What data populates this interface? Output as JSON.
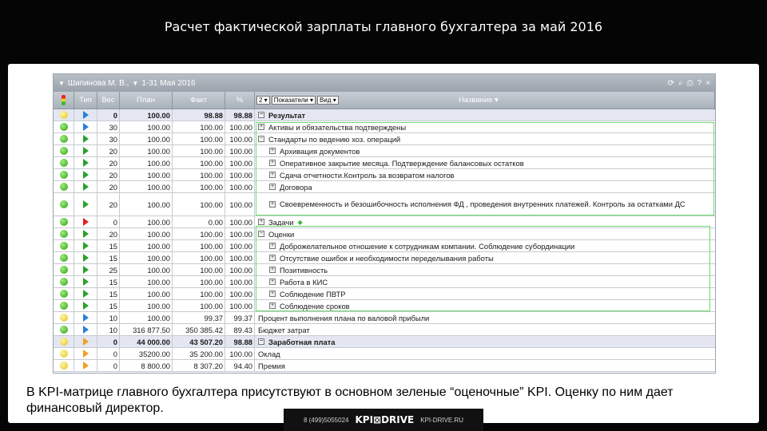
{
  "slide_title": "Расчет фактической зарплаты главного бухгалтера за май 2016",
  "window": {
    "user": "Шипинова М. В.,",
    "period": "1-31 Мая 2016",
    "icons": [
      "refresh-icon",
      "search-icon",
      "print-icon",
      "help-icon",
      "close-icon"
    ],
    "icon_glyphs": [
      "⟳",
      "🔍",
      "⎙",
      "?",
      "×"
    ]
  },
  "columns": {
    "type": "Тип",
    "weight": "Вес",
    "plan": "План",
    "fact": "Факт",
    "percent": "%",
    "level": "2",
    "indicators": "Показатели",
    "view": "Вид",
    "name": "Название"
  },
  "rows": [
    {
      "status": "yellow",
      "flag": "blue",
      "weight": "0",
      "plan": "100.00",
      "fact": "98.88",
      "pct": "98.88",
      "name": "Результат",
      "tree": "minus",
      "indent": 0,
      "bold": true,
      "hl": true
    },
    {
      "status": "green",
      "flag": "blue",
      "weight": "30",
      "plan": "100.00",
      "fact": "100.00",
      "pct": "100.00",
      "name": "Активы и обязательства подтверждены",
      "tree": "plus",
      "indent": 1
    },
    {
      "status": "green",
      "flag": "green",
      "weight": "30",
      "plan": "100.00",
      "fact": "100.00",
      "pct": "100.00",
      "name": "Стандарты по ведению хоз. операций",
      "tree": "minus",
      "indent": 1
    },
    {
      "status": "green",
      "flag": "green",
      "weight": "20",
      "plan": "100.00",
      "fact": "100.00",
      "pct": "100.00",
      "name": "Архивация документов",
      "tree": "plus",
      "indent": 2
    },
    {
      "status": "green",
      "flag": "green",
      "weight": "20",
      "plan": "100.00",
      "fact": "100.00",
      "pct": "100.00",
      "name": "Оперативное закрытие месяца. Подтверждение балансовых остатков",
      "tree": "plus",
      "indent": 2
    },
    {
      "status": "green",
      "flag": "green",
      "weight": "20",
      "plan": "100.00",
      "fact": "100.00",
      "pct": "100.00",
      "name": "Сдача отчетности.Контроль за возвратом налогов",
      "tree": "plus",
      "indent": 2
    },
    {
      "status": "green",
      "flag": "green",
      "weight": "20",
      "plan": "100.00",
      "fact": "100.00",
      "pct": "100.00",
      "name": "Договора",
      "tree": "plus",
      "indent": 2
    },
    {
      "status": "green",
      "flag": "green",
      "weight": "20",
      "plan": "100.00",
      "fact": "100.00",
      "pct": "100.00",
      "name": "Своевременность и безошибочность исполнения ФД , проведения внутренних платежей. Контроль за остатками ДС",
      "tree": "plus",
      "indent": 2,
      "tall": true
    },
    {
      "status": "green",
      "flag": "red",
      "weight": "0",
      "plan": "100.00",
      "fact": "0.00",
      "pct": "100.00",
      "name": "Задачи",
      "tree": "plus",
      "indent": 1,
      "diamond": true
    },
    {
      "status": "green",
      "flag": "green",
      "weight": "20",
      "plan": "100.00",
      "fact": "100.00",
      "pct": "100.00",
      "name": "Оценки",
      "tree": "minus",
      "indent": 1
    },
    {
      "status": "green",
      "flag": "green",
      "weight": "15",
      "plan": "100.00",
      "fact": "100.00",
      "pct": "100.00",
      "name": "Доброжелательное отношение к сотрудникам компании. Соблюдение субординации",
      "tree": "plus",
      "indent": 2
    },
    {
      "status": "green",
      "flag": "green",
      "weight": "15",
      "plan": "100.00",
      "fact": "100.00",
      "pct": "100.00",
      "name": "Отсутствие ошибок и необходимости переделывания работы",
      "tree": "plus",
      "indent": 2
    },
    {
      "status": "green",
      "flag": "green",
      "weight": "25",
      "plan": "100.00",
      "fact": "100.00",
      "pct": "100.00",
      "name": "Позитивность",
      "tree": "plus",
      "indent": 2
    },
    {
      "status": "green",
      "flag": "green",
      "weight": "15",
      "plan": "100.00",
      "fact": "100.00",
      "pct": "100.00",
      "name": "Работа в КИС",
      "tree": "plus",
      "indent": 2
    },
    {
      "status": "green",
      "flag": "green",
      "weight": "15",
      "plan": "100.00",
      "fact": "100.00",
      "pct": "100.00",
      "name": "Соблюдение ПВТР",
      "tree": "plus",
      "indent": 2
    },
    {
      "status": "green",
      "flag": "green",
      "weight": "15",
      "plan": "100.00",
      "fact": "100.00",
      "pct": "100.00",
      "name": "Соблюдение сроков",
      "tree": "plus",
      "indent": 2
    },
    {
      "status": "yellow",
      "flag": "blue",
      "weight": "10",
      "plan": "100.00",
      "fact": "99.37",
      "pct": "99.37",
      "name": "Процент выполнения плана по валовой прибыли",
      "tree": "",
      "indent": 1
    },
    {
      "status": "green",
      "flag": "blue",
      "weight": "10",
      "plan": "316 877.50",
      "fact": "350 385.42",
      "pct": "89.43",
      "name": "Бюджет затрат",
      "tree": "",
      "indent": 1
    },
    {
      "status": "yellow",
      "flag": "orange",
      "weight": "0",
      "plan": "44 000.00",
      "fact": "43 507.20",
      "pct": "98.88",
      "name": "Заработная плата",
      "tree": "minus",
      "indent": 0,
      "bold": true,
      "hl": true
    },
    {
      "status": "yellow",
      "flag": "orange",
      "weight": "0",
      "plan": "35200.00",
      "fact": "35 200.00",
      "pct": "100.00",
      "name": "Оклад",
      "tree": "",
      "indent": 1
    },
    {
      "status": "yellow",
      "flag": "orange",
      "weight": "0",
      "plan": "8 800.00",
      "fact": "8 307.20",
      "pct": "94.40",
      "name": "Премия",
      "tree": "",
      "indent": 1
    }
  ],
  "caption": "В KPI-матрице главного бухгалтера присутствуют в основном зеленые “оценочные” KPI. Оценку по ним дает финансовый директор.",
  "footer": {
    "phone": "8 (499)5055024",
    "logo": "KPI⊠DRIVE",
    "site": "KPI-DRIVE.RU"
  }
}
